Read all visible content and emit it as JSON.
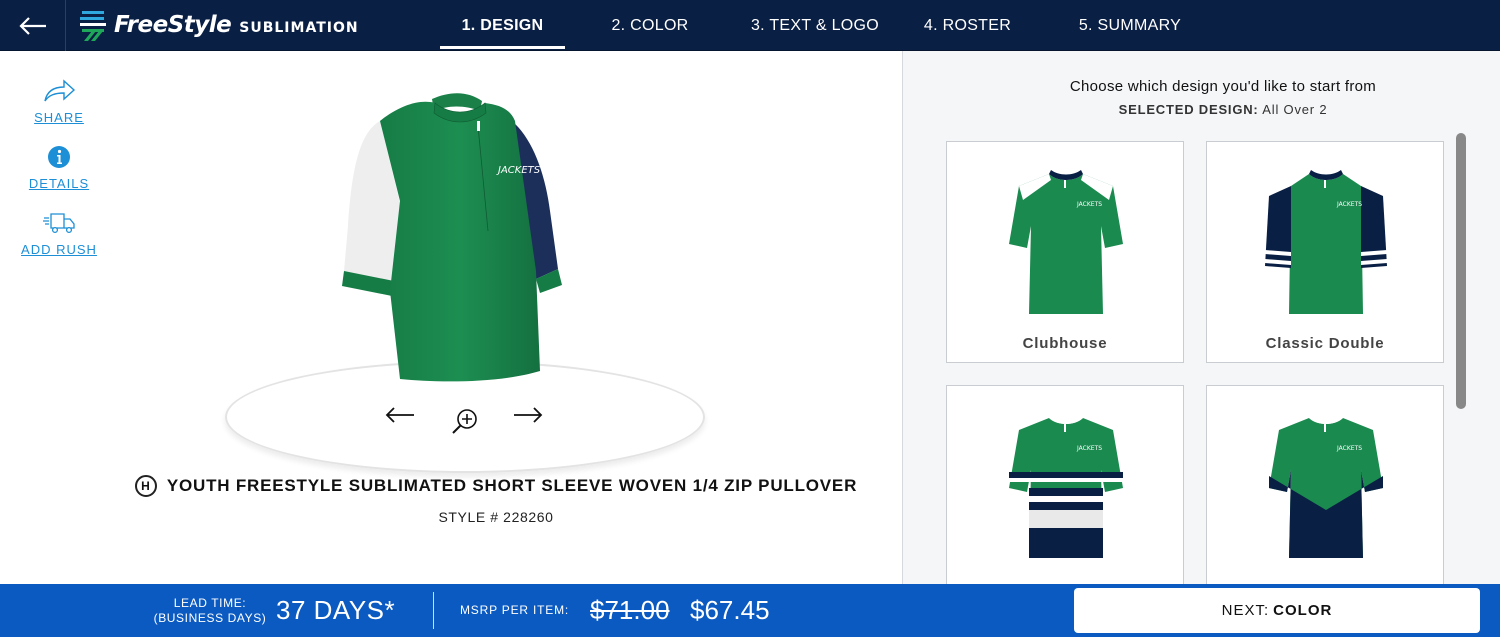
{
  "header": {
    "logo_text": "FreeStyle",
    "logo_sub": "SUBLIMATION",
    "tabs": [
      {
        "label": "1. DESIGN",
        "active": true
      },
      {
        "label": "2. COLOR",
        "active": false
      },
      {
        "label": "3. TEXT & LOGO",
        "active": false
      },
      {
        "label": "4. ROSTER",
        "active": false
      },
      {
        "label": "5. SUMMARY",
        "active": false
      }
    ]
  },
  "tools": {
    "share": "SHARE",
    "details": "DETAILS",
    "rush": "ADD RUSH"
  },
  "product": {
    "name": "YOUTH FREESTYLE SUBLIMATED SHORT SLEEVE WOVEN 1/4 ZIP PULLOVER",
    "style": "STYLE # 228260",
    "brand_glyph": "H",
    "shirt_text": "JACKETS"
  },
  "design_panel": {
    "heading": "Choose which design you'd like to start from",
    "selected_label": "SELECTED DESIGN:",
    "selected_value": "All Over 2",
    "designs": [
      {
        "name": "Clubhouse"
      },
      {
        "name": "Classic Double"
      },
      {
        "name": ""
      },
      {
        "name": ""
      }
    ]
  },
  "footer": {
    "lead_label_1": "LEAD TIME:",
    "lead_label_2": "(BUSINESS DAYS)",
    "lead_value": "37 DAYS*",
    "msrp_label": "MSRP PER ITEM:",
    "msrp_old": "$71.00",
    "msrp_new": "$67.45",
    "next_prefix": "NEXT:",
    "next_target": "COLOR"
  },
  "colors": {
    "navy": "#0a1f44",
    "green": "#1a8a4f",
    "footer_blue": "#0b5ac2",
    "link_blue": "#1d8fd6"
  },
  "icons": [
    "arrow-left-icon",
    "share-icon",
    "info-icon",
    "truck-icon",
    "rotate-left-icon",
    "zoom-in-icon",
    "rotate-right-icon",
    "brand-icon"
  ]
}
